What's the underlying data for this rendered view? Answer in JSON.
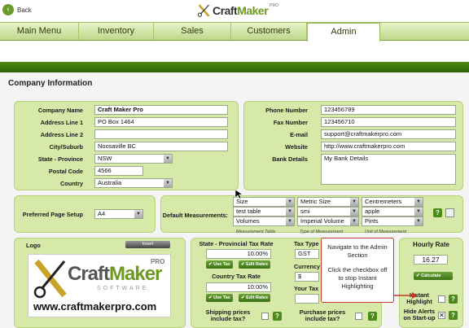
{
  "topbar": {
    "back_label": "Back",
    "logo_craft": "Craft",
    "logo_maker": "Maker",
    "logo_pro": "PRO"
  },
  "nav": {
    "tabs": [
      {
        "label": "Main Menu"
      },
      {
        "label": "Inventory"
      },
      {
        "label": "Sales"
      },
      {
        "label": "Customers"
      },
      {
        "label": "Admin"
      }
    ]
  },
  "section_title": "Company Information",
  "company": {
    "labels": [
      "Company Name",
      "Address Line 1",
      "Address Line 2",
      "City/Suburb",
      "State - Province",
      "Postal Code",
      "Country"
    ],
    "values": {
      "company_name": "Craft Maker Pro",
      "address1": "PO Box 1464",
      "address2": "",
      "city": "Noosaville BC",
      "state": "NSW",
      "postal": "4566",
      "country": "Australia"
    }
  },
  "contact": {
    "labels": [
      "Phone Number",
      "Fax Number",
      "E-mail",
      "Website",
      "Bank Details"
    ],
    "values": {
      "phone": "123456789",
      "fax": "123456710",
      "email": "support@craftmakerpro.com",
      "website": "http://www.craftmakerpro.com",
      "bank": "My Bank Details"
    }
  },
  "page_setup": {
    "label": "Preferred Page Setup",
    "value": "A4"
  },
  "measurements": {
    "label": "Default Measurements:",
    "rows": [
      [
        "Size",
        "Metric Size",
        "Centremeters"
      ],
      [
        "test table",
        "smi",
        "apple"
      ],
      [
        "Volumes",
        "Imperial Volume",
        "Pints"
      ]
    ],
    "captions": [
      "Measurement Table",
      "Type of Measurement",
      "Unit of Measurement"
    ]
  },
  "logo": {
    "label": "Logo",
    "insert_label": "Insert",
    "url": "www.craftmakerpro.com",
    "logo_craft": "Craft",
    "logo_maker": "Maker",
    "logo_pro": "PRO",
    "logo_software": "SOFTWARE"
  },
  "tax": {
    "state_label": "State - Provincial Tax Rate",
    "state_value": "10.00%",
    "country_label": "Country Tax Rate",
    "country_value": "10.00%",
    "use_tax": "Use Tax",
    "edit_rates": "Edit Rates",
    "tax_type_label": "Tax Type",
    "tax_type_value": "GST",
    "currency_label": "Currency",
    "currency_value": "$",
    "your_tax_label": "Your Tax",
    "shipping_label": "Shipping prices include tax?",
    "purchase_label": "Purchase prices include tax?"
  },
  "hourly": {
    "label": "Hourly Rate",
    "value": "16.27",
    "calculate": "Calculate",
    "instant_label": "Instant Highlight",
    "alerts_label": "Hide Alerts on Start-up"
  },
  "callout": {
    "line1": "Navigate to the Admin Section",
    "line2": "Click the checkbox off to stop Instant Highlighting"
  },
  "help_label": "?",
  "colors": {
    "panel": "#d6e9a8",
    "accent": "#2d6606",
    "callout_border": "#c0392b"
  }
}
